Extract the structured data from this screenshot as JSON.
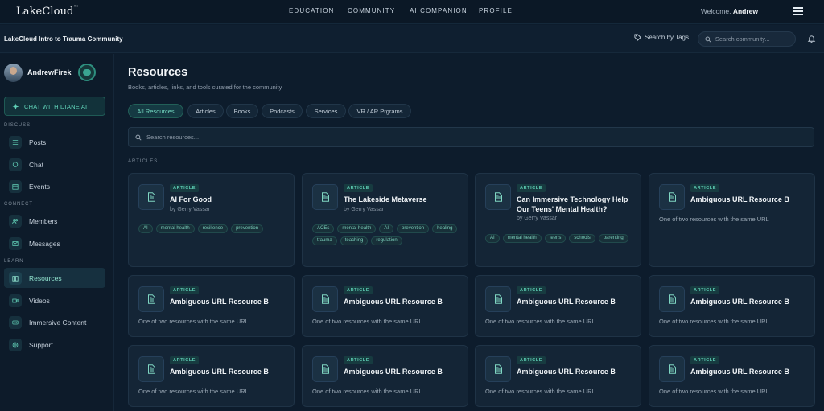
{
  "app": {
    "logo": "LakeCloud",
    "logo_mark": "™",
    "nav": [
      "EDUCATION",
      "COMMUNITY",
      "AI COMPANION",
      "PROFILE"
    ],
    "welcome_prefix": "Welcome,",
    "welcome_name": "Andrew"
  },
  "subbar": {
    "community_name": "LakeCloud Intro to Trauma Community",
    "search_by_tags": "Search by Tags",
    "search_placeholder": "Search community..."
  },
  "sidebar": {
    "username": "AndrewFirek",
    "chat_ai_label": "CHAT WITH DIANE AI",
    "sections": [
      {
        "label": "DISCUSS",
        "items": [
          {
            "label": "Posts",
            "icon": "list-icon"
          },
          {
            "label": "Chat",
            "icon": "chat-bubble-icon"
          },
          {
            "label": "Events",
            "icon": "calendar-icon"
          }
        ]
      },
      {
        "label": "CONNECT",
        "items": [
          {
            "label": "Members",
            "icon": "people-icon"
          },
          {
            "label": "Messages",
            "icon": "mail-icon"
          }
        ]
      },
      {
        "label": "LEARN",
        "items": [
          {
            "label": "Resources",
            "icon": "book-icon",
            "active": true
          },
          {
            "label": "Videos",
            "icon": "video-icon"
          },
          {
            "label": "Immersive Content",
            "icon": "vr-headset-icon"
          },
          {
            "label": "Support",
            "icon": "support-icon"
          }
        ]
      }
    ]
  },
  "main": {
    "title": "Resources",
    "subtitle": "Books, articles, links, and tools curated for the community",
    "filters": [
      "All Resources",
      "Articles",
      "Books",
      "Podcasts",
      "Services",
      "VR / AR Prgrams"
    ],
    "active_filter": "All Resources",
    "search_placeholder": "Search resources...",
    "section_label": "ARTICLES",
    "cards": [
      {
        "badge": "ARTICLE",
        "title": "AI For Good",
        "author": "by Gerry Vassar",
        "tags": [
          "AI",
          "mental health",
          "resilience",
          "prevention"
        ]
      },
      {
        "badge": "ARTICLE",
        "title": "The Lakeside Metaverse",
        "author": "by Gerry Vassar",
        "tags": [
          "ACEs",
          "mental health",
          "AI",
          "prevention",
          "healing",
          "trauma",
          "teaching",
          "regulation"
        ]
      },
      {
        "badge": "ARTICLE",
        "title": "Can Immersive Technology Help Our Teens' Mental Health?",
        "author": "by Gerry Vassar",
        "tags": [
          "AI",
          "mental health",
          "teens",
          "schools",
          "parenting"
        ]
      },
      {
        "badge": "ARTICLE",
        "title": "Ambiguous URL Resource B",
        "desc": "One of two resources with the same URL"
      },
      {
        "badge": "ARTICLE",
        "title": "Ambiguous URL Resource B",
        "desc": "One of two resources with the same URL"
      },
      {
        "badge": "ARTICLE",
        "title": "Ambiguous URL Resource B",
        "desc": "One of two resources with the same URL"
      },
      {
        "badge": "ARTICLE",
        "title": "Ambiguous URL Resource B",
        "desc": "One of two resources with the same URL"
      },
      {
        "badge": "ARTICLE",
        "title": "Ambiguous URL Resource B",
        "desc": "One of two resources with the same URL"
      },
      {
        "badge": "ARTICLE",
        "title": "Ambiguous URL Resource B",
        "desc": "One of two resources with the same URL"
      },
      {
        "badge": "ARTICLE",
        "title": "Ambiguous URL Resource B",
        "desc": "One of two resources with the same URL"
      },
      {
        "badge": "ARTICLE",
        "title": "Ambiguous URL Resource B",
        "desc": "One of two resources with the same URL"
      },
      {
        "badge": "ARTICLE",
        "title": "Ambiguous URL Resource B",
        "desc": "One of two resources with the same URL"
      }
    ]
  },
  "colors": {
    "background": "#0d1c2c",
    "accent": "#5dcdb3",
    "card": "#142536"
  }
}
